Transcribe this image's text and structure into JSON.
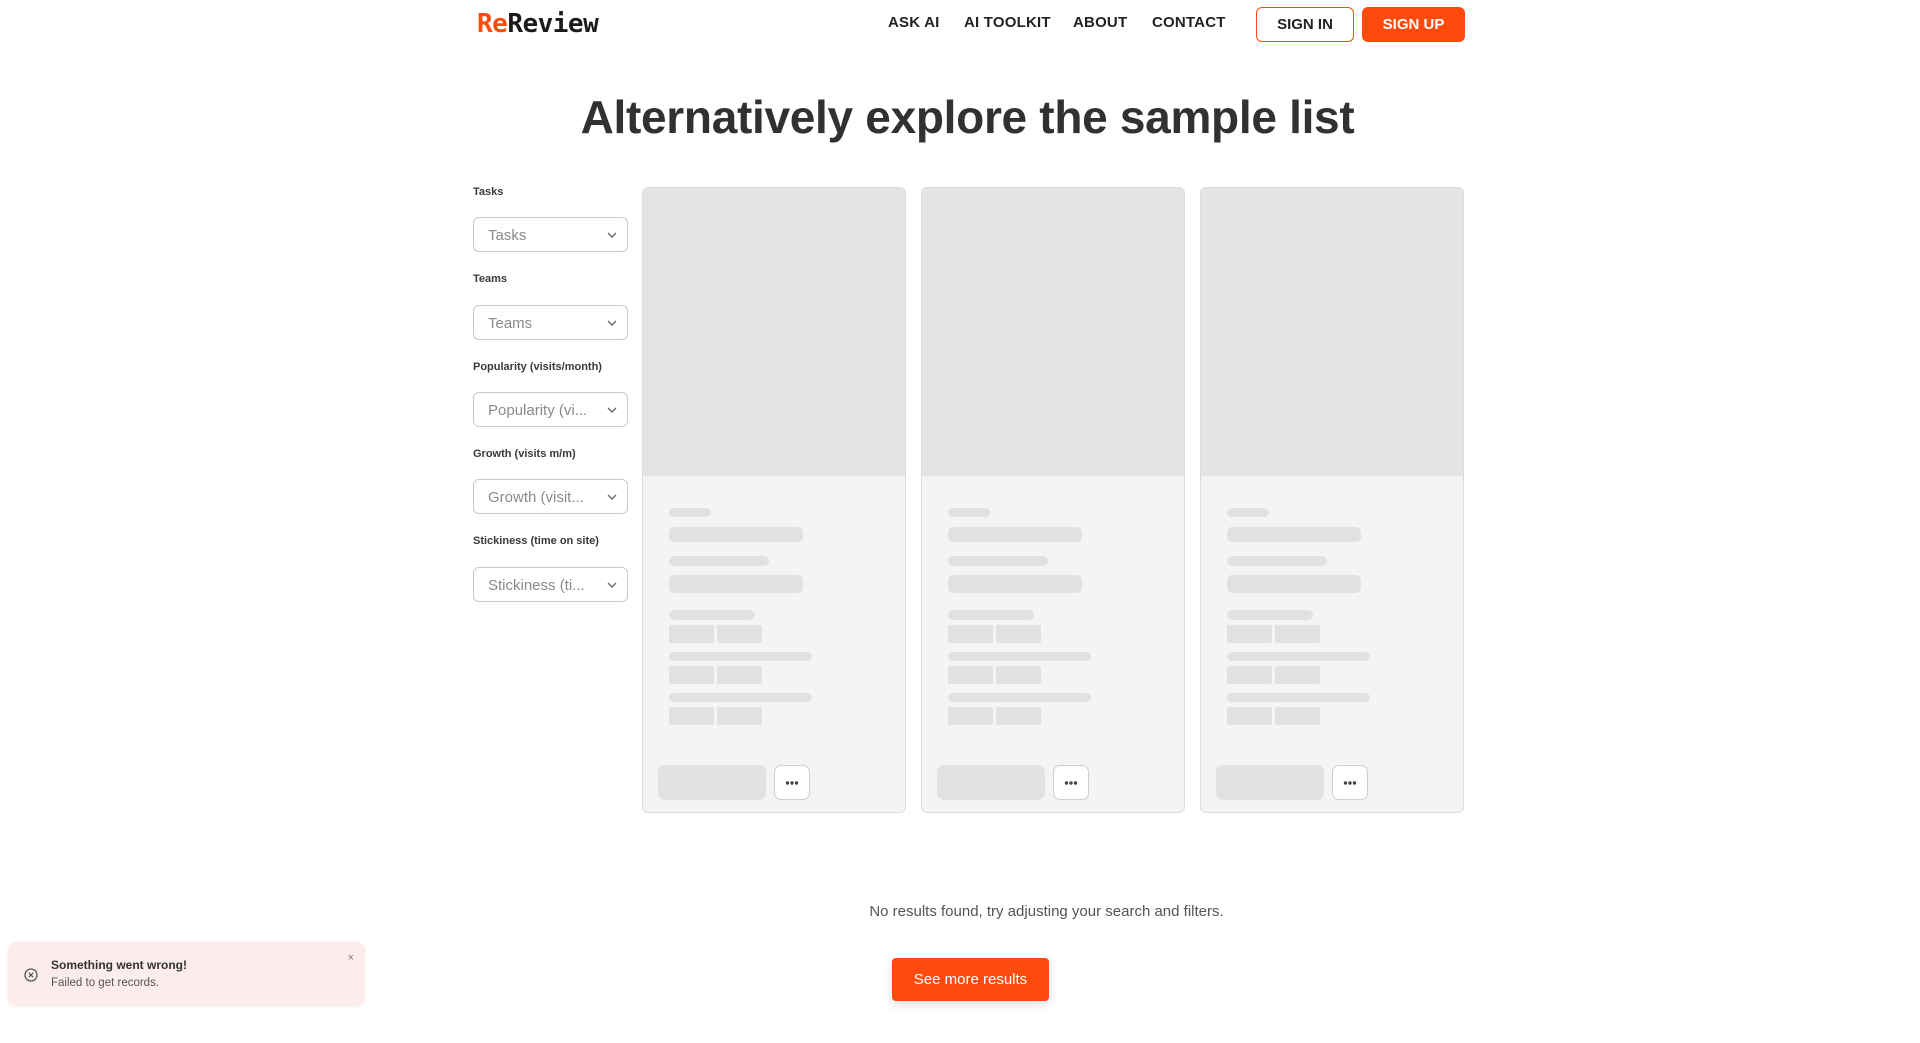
{
  "header": {
    "logo_part1": "Re",
    "logo_part2": "Review",
    "nav": [
      "ASK AI",
      "AI TOOLKIT",
      "ABOUT",
      "CONTACT"
    ],
    "signin_label": "SIGN IN",
    "signup_label": "SIGN UP"
  },
  "main": {
    "title": "Alternatively explore the sample list",
    "no_results": "No results found, try adjusting your search and filters.",
    "see_more_label": "See more results"
  },
  "filters": [
    {
      "label": "Tasks",
      "placeholder": "Tasks"
    },
    {
      "label": "Teams",
      "placeholder": "Teams"
    },
    {
      "label": "Popularity (visits/month)",
      "placeholder": "Popularity (vi..."
    },
    {
      "label": "Growth (visits m/m)",
      "placeholder": "Growth (visit..."
    },
    {
      "label": "Stickiness (time on site)",
      "placeholder": "Stickiness (ti..."
    }
  ],
  "cards": [
    {
      "state": "loading"
    },
    {
      "state": "loading"
    },
    {
      "state": "loading"
    }
  ],
  "toast": {
    "title": "Something went wrong!",
    "message": "Failed to get records.",
    "close": "×"
  },
  "colors": {
    "brand": "#ff4a0d",
    "skeleton": "#e1e1e1",
    "toast_bg": "#fdecec"
  },
  "icons": {
    "chevron": "chevron-down-icon",
    "more": "more-dots-icon",
    "error": "error-circle-icon",
    "close": "close-icon"
  }
}
